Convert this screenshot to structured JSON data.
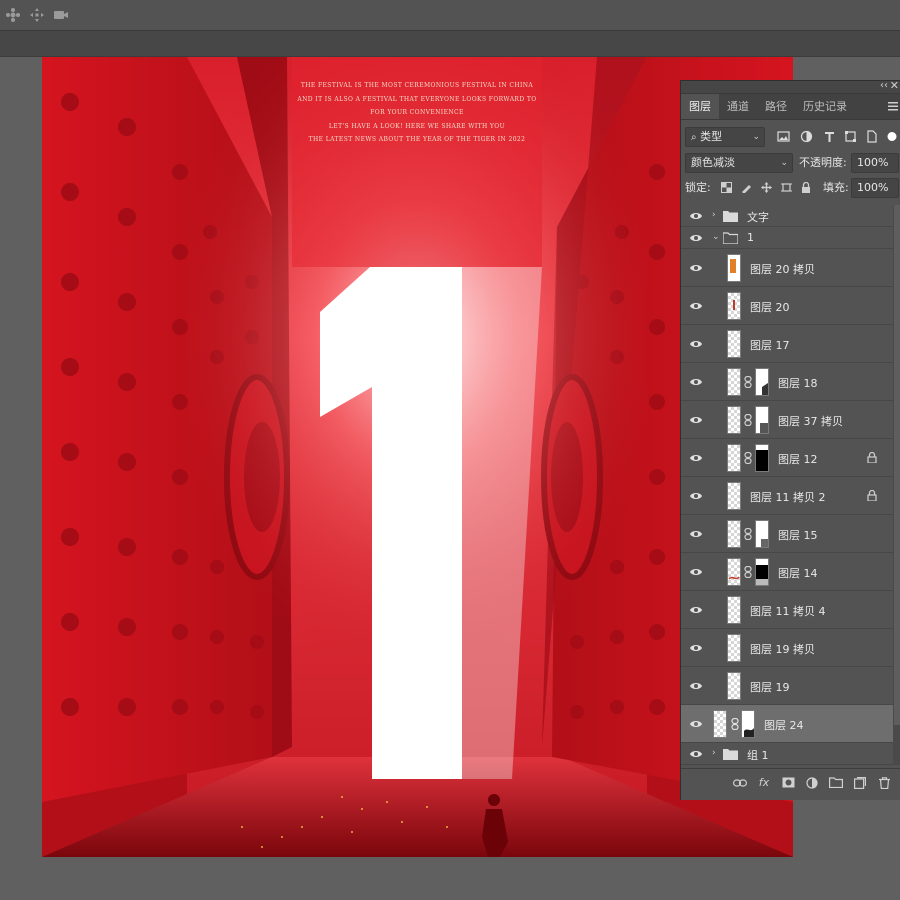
{
  "poster": {
    "lines": [
      "THE FESTIVAL IS THE MOST CEREMONIOUS FESTIVAL IN CHINA",
      "AND IT IS ALSO A FESTIVAL THAT EVERYONE LOOKS FORWARD TO",
      "FOR YOUR CONVENIENCE",
      "LET'S HAVE A LOOK! HERE WE SHARE WITH YOU",
      "THE LATEST NEWS ABOUT THE YEAR OF THE TIGER IN 2022"
    ],
    "big_numeral": "1",
    "colors": {
      "door": "#c8141f",
      "door_dark": "#8e0a12",
      "glow": "#ffffff"
    }
  },
  "panel": {
    "tabs": [
      {
        "label": "图层",
        "active": true
      },
      {
        "label": "通道",
        "active": false
      },
      {
        "label": "路径",
        "active": false
      },
      {
        "label": "历史记录",
        "active": false
      }
    ],
    "filter": {
      "kind": "类型"
    },
    "blend_mode": "颜色减淡",
    "opacity_label": "不透明度:",
    "opacity": "100%",
    "lock_label": "锁定:",
    "fill_label": "填充:",
    "fill": "100%",
    "layers": [
      {
        "name": "文字",
        "type": "group",
        "expanded": false
      },
      {
        "name": "1",
        "type": "group",
        "expanded": true
      },
      {
        "name": "图层 20 拷贝",
        "type": "layer"
      },
      {
        "name": "图层 20",
        "type": "layer"
      },
      {
        "name": "图层 17",
        "type": "layer"
      },
      {
        "name": "图层 18",
        "type": "masked"
      },
      {
        "name": "图层 37 拷贝",
        "type": "masked"
      },
      {
        "name": "图层 12",
        "type": "masked",
        "locked": true
      },
      {
        "name": "图层 11 拷贝 2",
        "type": "layer",
        "locked": true
      },
      {
        "name": "图层 15",
        "type": "masked"
      },
      {
        "name": "图层 14",
        "type": "masked"
      },
      {
        "name": "图层 11 拷贝 4",
        "type": "layer"
      },
      {
        "name": "图层 19 拷贝",
        "type": "layer"
      },
      {
        "name": "图层 19",
        "type": "layer"
      },
      {
        "name": "图层 24",
        "type": "masked",
        "selected": true
      },
      {
        "name": "组 1",
        "type": "group",
        "expanded": false
      }
    ],
    "footer_icons": [
      "link-icon",
      "fx-icon",
      "add-mask-icon",
      "adjustment-icon",
      "new-group-icon",
      "new-layer-icon",
      "trash-icon"
    ],
    "fx_glyph": "fx"
  }
}
